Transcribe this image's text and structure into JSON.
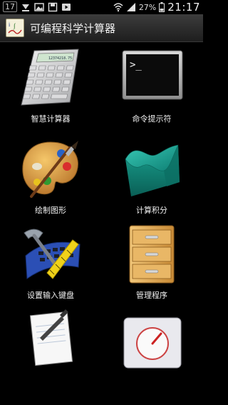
{
  "status_bar": {
    "notification_count": "17",
    "battery_percent": "27%",
    "time": "21:17",
    "icons": [
      "notification-count-icon",
      "download-icon",
      "image-icon",
      "save-icon",
      "play-icon",
      "wifi-icon",
      "signal-icon",
      "battery-icon"
    ]
  },
  "app": {
    "title": "可编程科学计算器",
    "icon": "calculator-app-icon"
  },
  "tiles": [
    {
      "label": "智慧计算器",
      "icon": "calculator-icon"
    },
    {
      "label": "命令提示符",
      "icon": "terminal-icon"
    },
    {
      "label": "绘制图形",
      "icon": "palette-icon"
    },
    {
      "label": "计算积分",
      "icon": "surface-graph-icon"
    },
    {
      "label": "设置输入键盘",
      "icon": "keyboard-tools-icon"
    },
    {
      "label": "管理程序",
      "icon": "file-cabinet-icon"
    },
    {
      "label": "",
      "icon": "notepad-pen-icon"
    },
    {
      "label": "",
      "icon": "settings-icon"
    }
  ],
  "colors": {
    "background": "#000000",
    "titlebar": "#2b2b2b",
    "text": "#f0f0f0"
  }
}
